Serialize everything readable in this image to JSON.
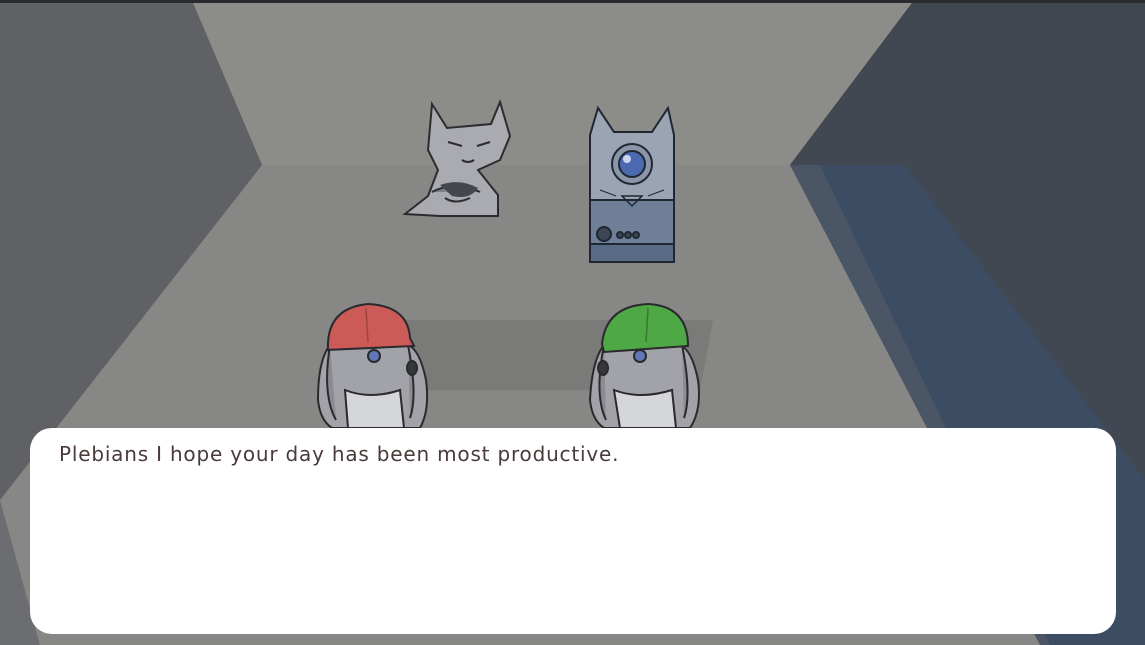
{
  "dialog": {
    "text": "Plebians I hope your day has been most productive."
  },
  "characters": [
    {
      "id": "grumpy-cat",
      "icon": "grumpy-cat-sprite"
    },
    {
      "id": "robot-cat",
      "icon": "robot-cat-terminal-sprite"
    },
    {
      "id": "worker-dog-red",
      "icon": "dog-red-hardhat-sprite",
      "hat_color": "#cc5a57"
    },
    {
      "id": "worker-dog-green",
      "icon": "dog-green-hardhat-sprite",
      "hat_color": "#4ea846"
    }
  ],
  "colors": {
    "wall_left": "#5f6164",
    "wall_back": "#8a8a87",
    "floor": "#878785",
    "wall_right": "#3e4550",
    "dialog_bg": "#ffffff",
    "dialog_text": "#4a3a3a"
  }
}
